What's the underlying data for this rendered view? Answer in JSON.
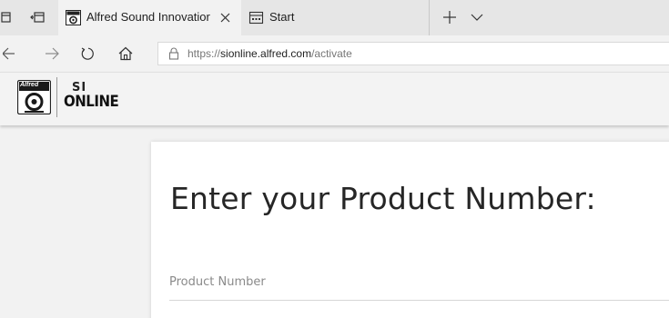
{
  "browser": {
    "tabs": [
      {
        "title": "Alfred Sound Innovatior",
        "active": true
      },
      {
        "title": "Start",
        "active": false
      }
    ],
    "address_bar": {
      "scheme": "https://",
      "host": "sionline.alfred.com",
      "path": "/activate"
    },
    "icons": {
      "set_aside": "tabs-aside-icon",
      "restore": "restore-tabs-icon",
      "back": "back-arrow-icon",
      "forward": "forward-arrow-icon",
      "refresh": "refresh-icon",
      "home": "home-icon",
      "lock": "lock-icon",
      "new_tab": "plus-icon",
      "tab_list": "chevron-down-icon",
      "close": "close-icon"
    }
  },
  "site": {
    "logo_text": "Alfred",
    "brand_line1": "SI",
    "brand_line2": "ONLINE"
  },
  "main": {
    "heading": "Enter your Product Number:",
    "product_number_label": "Product Number",
    "product_number_value": ""
  },
  "colors": {
    "tabstrip": "#e6e6e6",
    "page_background": "#f2f2f2",
    "card": "#ffffff",
    "heading_text": "#262626",
    "label_text": "#8a8a8a"
  }
}
